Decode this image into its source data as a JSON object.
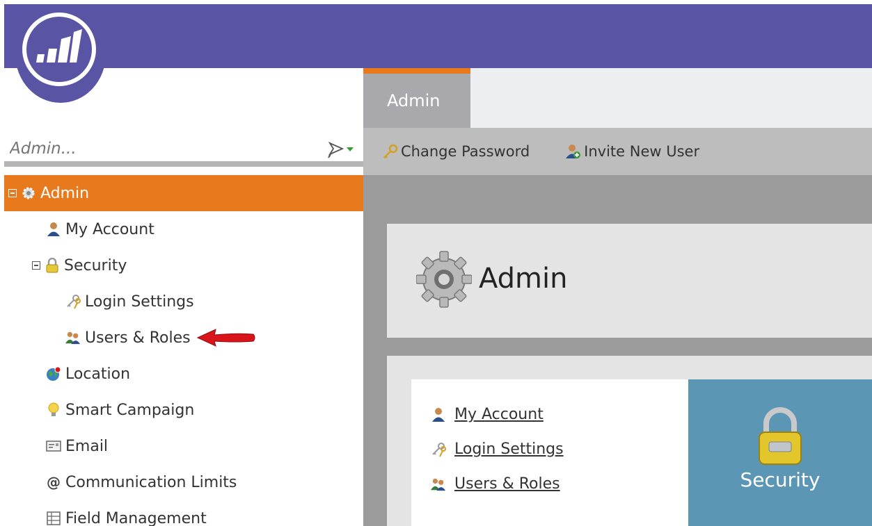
{
  "sidebar": {
    "search_placeholder": "Admin...",
    "items": [
      {
        "label": "Admin"
      },
      {
        "label": "My Account"
      },
      {
        "label": "Security"
      },
      {
        "label": "Login Settings"
      },
      {
        "label": "Users & Roles"
      },
      {
        "label": "Location"
      },
      {
        "label": "Smart Campaign"
      },
      {
        "label": "Email"
      },
      {
        "label": "Communication Limits"
      },
      {
        "label": "Field Management"
      }
    ]
  },
  "tabs": [
    {
      "label": "Admin"
    }
  ],
  "toolbar": {
    "change_password": "Change Password",
    "invite_new_user": "Invite New User"
  },
  "main": {
    "title": "Admin",
    "links": [
      {
        "label": "My Account"
      },
      {
        "label": "Login Settings"
      },
      {
        "label": "Users & Roles"
      }
    ],
    "security_tile": "Security"
  },
  "colors": {
    "brand_purple": "#5a54a4",
    "accent_orange": "#e8791c",
    "tile_blue": "#5b97b4"
  }
}
